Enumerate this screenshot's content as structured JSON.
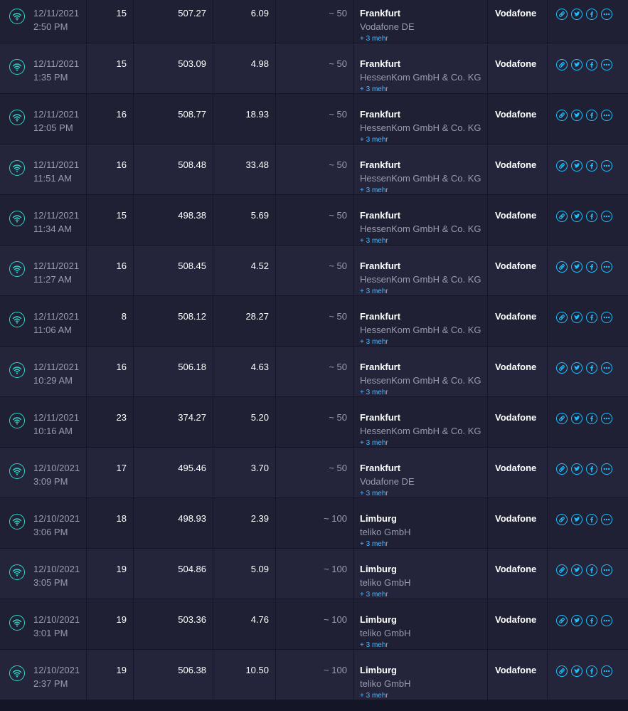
{
  "colors": {
    "row_background": "#1f2033",
    "row_background_alt": "#24253a",
    "page_background": "#141526",
    "wifi_icon": "#2fd6c9",
    "share_icons": "#1ec0ff",
    "link": "#4fb6ff",
    "muted_text": "#9a9bb0",
    "primary_text": "#ffffff"
  },
  "icons": {
    "connection": "wifi-icon",
    "share": [
      "link-icon",
      "twitter-icon",
      "facebook-icon",
      "more-icon"
    ]
  },
  "results": [
    {
      "date": "12/11/2021",
      "time": "2:50 PM",
      "ping": "15",
      "download": "507.27",
      "upload": "6.09",
      "distance": "~ 50",
      "city": "Frankfurt",
      "sponsor": "Vodafone DE",
      "more": "+ 3 mehr",
      "isp": "Vodafone"
    },
    {
      "date": "12/11/2021",
      "time": "1:35 PM",
      "ping": "15",
      "download": "503.09",
      "upload": "4.98",
      "distance": "~ 50",
      "city": "Frankfurt",
      "sponsor": "HessenKom GmbH & Co. KG",
      "more": "+ 3 mehr",
      "isp": "Vodafone"
    },
    {
      "date": "12/11/2021",
      "time": "12:05 PM",
      "ping": "16",
      "download": "508.77",
      "upload": "18.93",
      "distance": "~ 50",
      "city": "Frankfurt",
      "sponsor": "HessenKom GmbH & Co. KG",
      "more": "+ 3 mehr",
      "isp": "Vodafone"
    },
    {
      "date": "12/11/2021",
      "time": "11:51 AM",
      "ping": "16",
      "download": "508.48",
      "upload": "33.48",
      "distance": "~ 50",
      "city": "Frankfurt",
      "sponsor": "HessenKom GmbH & Co. KG",
      "more": "+ 3 mehr",
      "isp": "Vodafone"
    },
    {
      "date": "12/11/2021",
      "time": "11:34 AM",
      "ping": "15",
      "download": "498.38",
      "upload": "5.69",
      "distance": "~ 50",
      "city": "Frankfurt",
      "sponsor": "HessenKom GmbH & Co. KG",
      "more": "+ 3 mehr",
      "isp": "Vodafone"
    },
    {
      "date": "12/11/2021",
      "time": "11:27 AM",
      "ping": "16",
      "download": "508.45",
      "upload": "4.52",
      "distance": "~ 50",
      "city": "Frankfurt",
      "sponsor": "HessenKom GmbH & Co. KG",
      "more": "+ 3 mehr",
      "isp": "Vodafone"
    },
    {
      "date": "12/11/2021",
      "time": "11:06 AM",
      "ping": "8",
      "download": "508.12",
      "upload": "28.27",
      "distance": "~ 50",
      "city": "Frankfurt",
      "sponsor": "HessenKom GmbH & Co. KG",
      "more": "+ 3 mehr",
      "isp": "Vodafone"
    },
    {
      "date": "12/11/2021",
      "time": "10:29 AM",
      "ping": "16",
      "download": "506.18",
      "upload": "4.63",
      "distance": "~ 50",
      "city": "Frankfurt",
      "sponsor": "HessenKom GmbH & Co. KG",
      "more": "+ 3 mehr",
      "isp": "Vodafone"
    },
    {
      "date": "12/11/2021",
      "time": "10:16 AM",
      "ping": "23",
      "download": "374.27",
      "upload": "5.20",
      "distance": "~ 50",
      "city": "Frankfurt",
      "sponsor": "HessenKom GmbH & Co. KG",
      "more": "+ 3 mehr",
      "isp": "Vodafone"
    },
    {
      "date": "12/10/2021",
      "time": "3:09 PM",
      "ping": "17",
      "download": "495.46",
      "upload": "3.70",
      "distance": "~ 50",
      "city": "Frankfurt",
      "sponsor": "Vodafone DE",
      "more": "+ 3 mehr",
      "isp": "Vodafone"
    },
    {
      "date": "12/10/2021",
      "time": "3:06 PM",
      "ping": "18",
      "download": "498.93",
      "upload": "2.39",
      "distance": "~ 100",
      "city": "Limburg",
      "sponsor": "teliko GmbH",
      "more": "+ 3 mehr",
      "isp": "Vodafone"
    },
    {
      "date": "12/10/2021",
      "time": "3:05 PM",
      "ping": "19",
      "download": "504.86",
      "upload": "5.09",
      "distance": "~ 100",
      "city": "Limburg",
      "sponsor": "teliko GmbH",
      "more": "+ 3 mehr",
      "isp": "Vodafone"
    },
    {
      "date": "12/10/2021",
      "time": "3:01 PM",
      "ping": "19",
      "download": "503.36",
      "upload": "4.76",
      "distance": "~ 100",
      "city": "Limburg",
      "sponsor": "teliko GmbH",
      "more": "+ 3 mehr",
      "isp": "Vodafone"
    },
    {
      "date": "12/10/2021",
      "time": "2:37 PM",
      "ping": "19",
      "download": "506.38",
      "upload": "10.50",
      "distance": "~ 100",
      "city": "Limburg",
      "sponsor": "teliko GmbH",
      "more": "+ 3 mehr",
      "isp": "Vodafone"
    }
  ]
}
